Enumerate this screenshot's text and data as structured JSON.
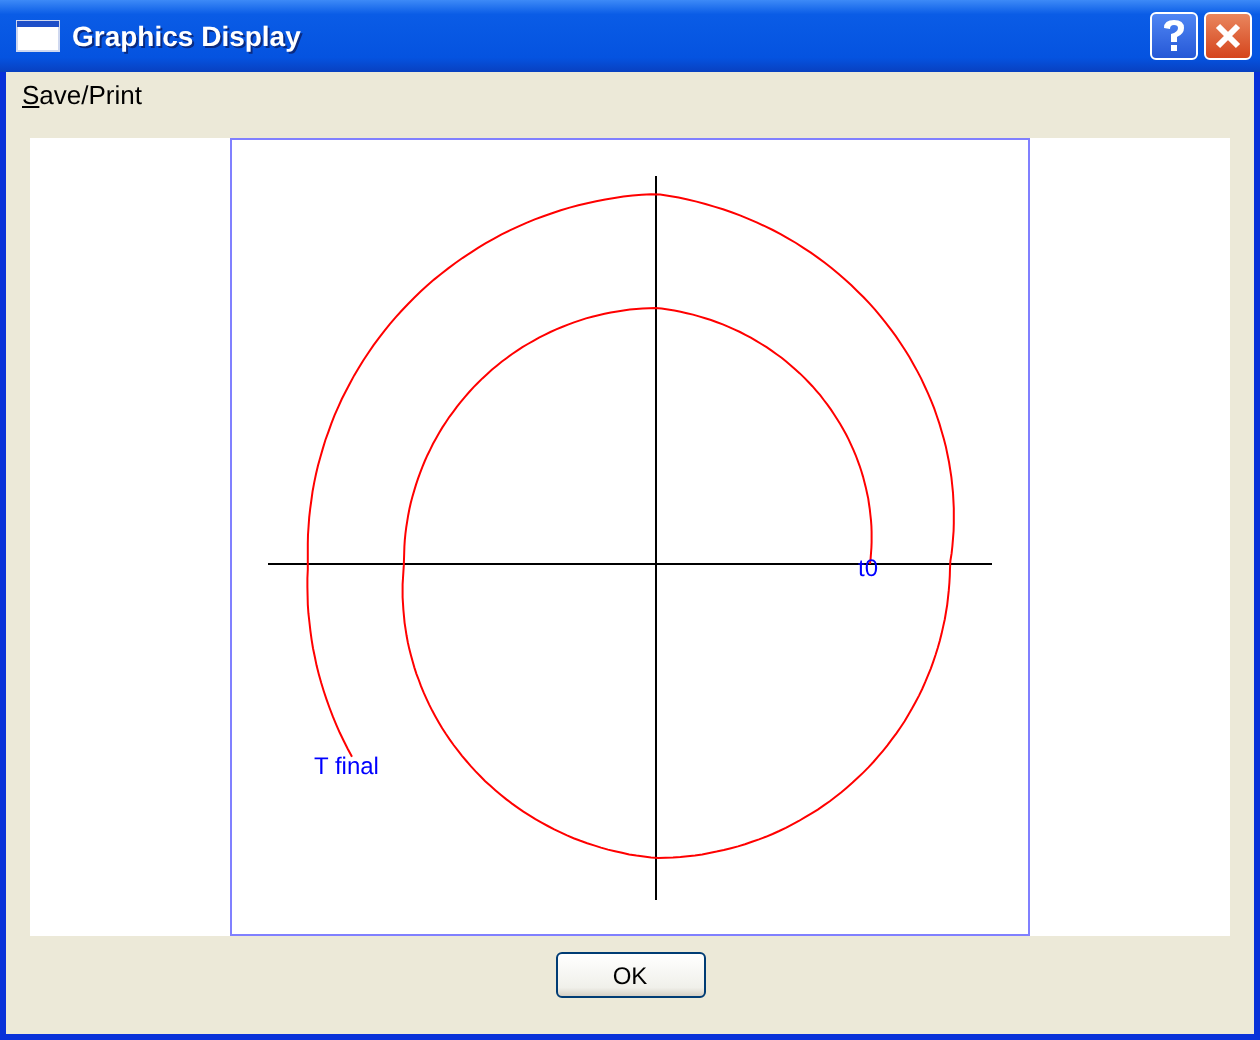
{
  "window": {
    "title": "Graphics Display"
  },
  "menu": [
    {
      "label": "Save/Print"
    }
  ],
  "plot": {
    "start_label": "t0",
    "end_label": "T final"
  },
  "buttons": [
    "OK"
  ]
}
